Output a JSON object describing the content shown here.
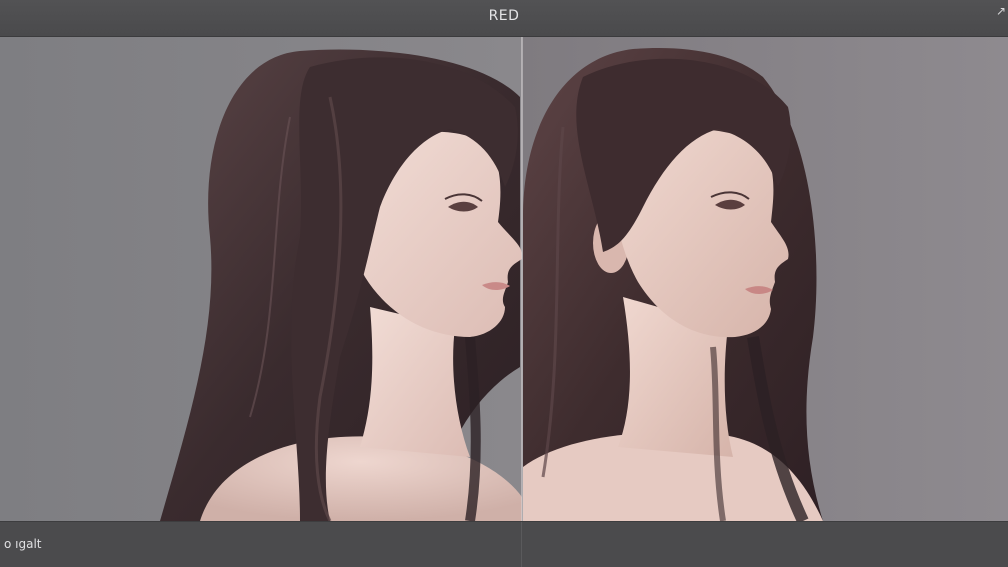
{
  "header": {
    "title": "RED",
    "corner_icon": "pin-icon"
  },
  "viewer": {
    "left_image": "portrait-profile-left",
    "right_image": "portrait-profile-right"
  },
  "footer": {
    "status_text": "o ıgalt"
  },
  "colors": {
    "toolbar": "#4a4a4c",
    "backdrop": "#7d7c80",
    "hair": "#3a2a2c",
    "skin": "#e9cfc8"
  }
}
